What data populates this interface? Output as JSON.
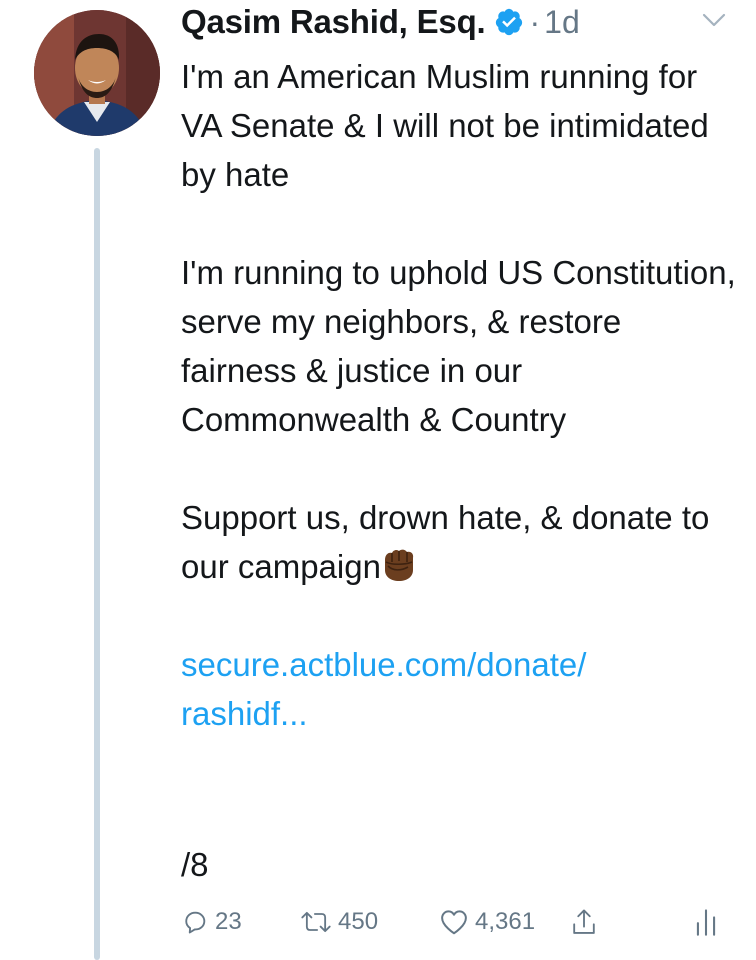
{
  "author": {
    "name": "Qasim Rashid, Esq.",
    "verified": true,
    "separator": "·",
    "time": "1d"
  },
  "tweet": {
    "paragraphs": [
      "I'm an American Muslim running for VA Senate & I will not be intimidated by hate",
      "I'm running to uphold US Constitution, serve my neighbors, & restore fairness & justice in our Commonwealth & Country",
      "Support us, drown hate, & donate to our campaign"
    ],
    "emoji": "raised-fist-medium-dark-skin",
    "link_line1": "secure.actblue.com/donate/",
    "link_line2": "rashidf...",
    "thread_count": "/8"
  },
  "actions": {
    "replies": "23",
    "retweets": "450",
    "likes": "4,361"
  },
  "colors": {
    "link": "#1da1f2",
    "secondary": "#657786",
    "thread_line": "#c8d6e1"
  }
}
